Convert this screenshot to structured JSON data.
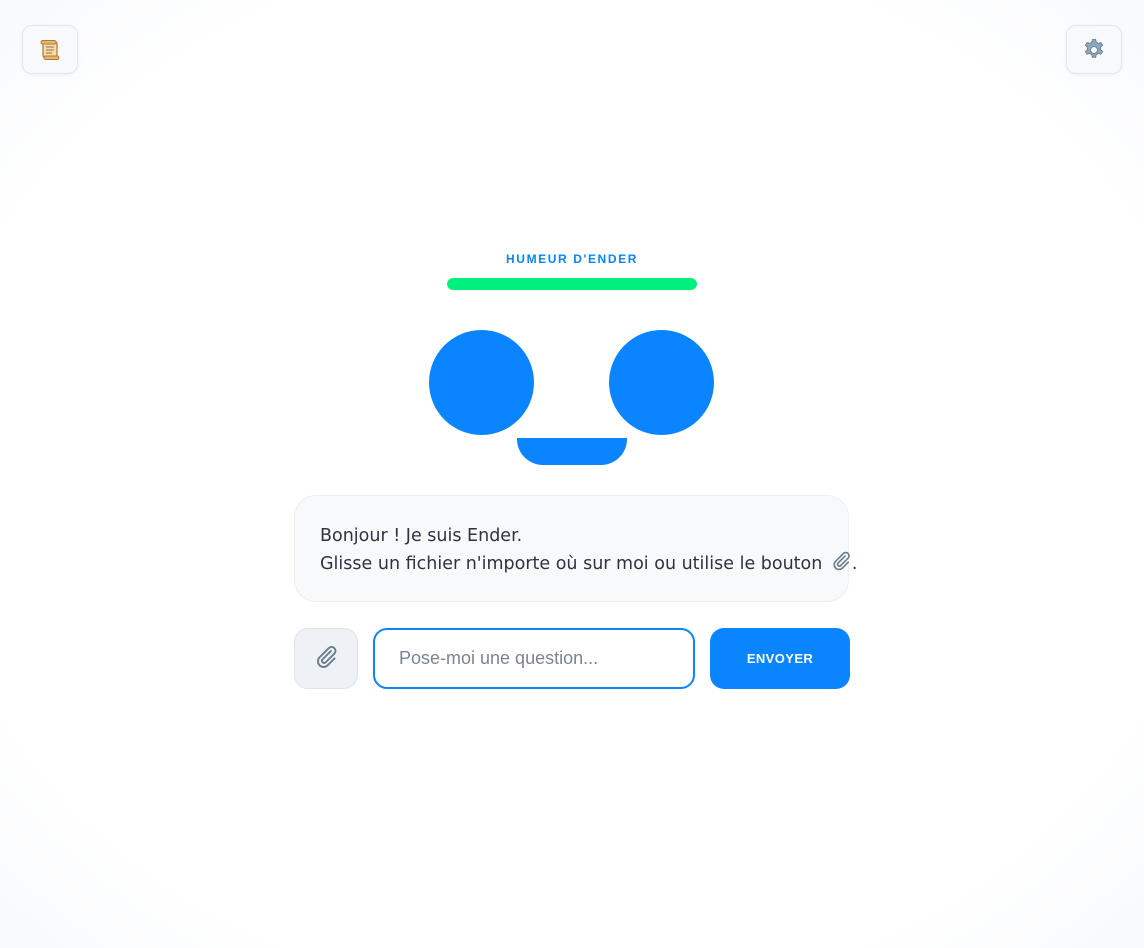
{
  "top_bar": {
    "history_icon": "scroll-icon",
    "settings_icon": "gear-icon"
  },
  "mood": {
    "label": "HUMEUR D'ENDER",
    "level": 1.0,
    "color": "#00f07e"
  },
  "face": {
    "color": "#0a84ff"
  },
  "message": {
    "line1": "Bonjour ! Je suis Ender.",
    "line2": "Glisse un fichier n'importe où sur moi ou utilise le bouton",
    "line2_suffix": ".",
    "inline_icon": "paperclip-icon"
  },
  "composer": {
    "attach_icon": "paperclip-icon",
    "input_value": "",
    "input_placeholder": "Pose-moi une question...",
    "send_label": "ENVOYER"
  },
  "colors": {
    "accent": "#0a84ff",
    "mood_fill": "#00f07e"
  }
}
